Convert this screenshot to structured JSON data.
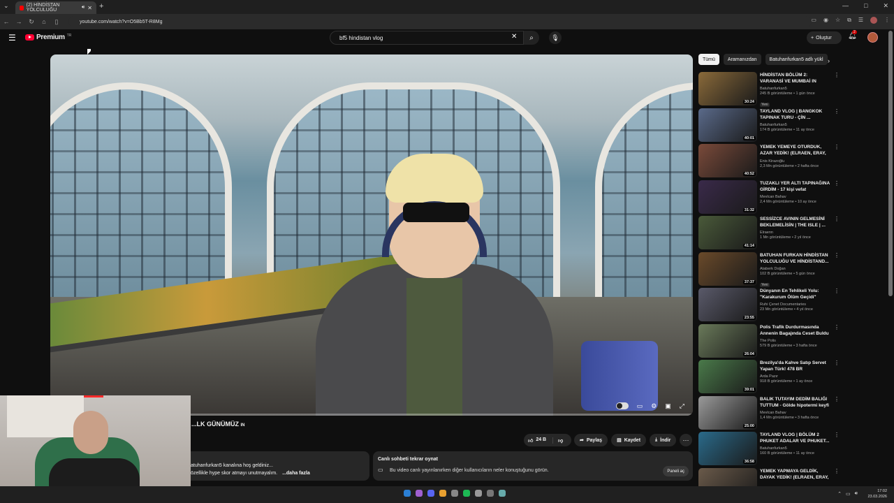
{
  "browser": {
    "tab_title": "(2) HİNDİSTAN YOLCULUĞU",
    "url": "youtube.com/watch?v=O5Bb5T-R8Mg",
    "new_tab_icon": "+",
    "minimize_icon": "—",
    "maximize_icon": "□",
    "close_icon": "✕"
  },
  "header": {
    "logo_text": "Premium",
    "logo_suffix": "TR",
    "search_value": "bf5 hindistan vlog",
    "create_label": "Oluştur",
    "notif_count": "2"
  },
  "video": {
    "title": "...LK GÜNÜMÜZ",
    "title_suffix": "IN",
    "like_count": "24 B",
    "share_label": "Paylaş",
    "save_label": "Kaydet",
    "download_label": "İndir"
  },
  "description": {
    "line1": "atuhanfurkan5 kanalına hoş geldiniz...",
    "line2": "özellikle hype skor atmayı unutmayalım.",
    "more": "...daha fazla"
  },
  "live_chat": {
    "heading": "Canlı sohbeti tekrar oynat",
    "text": "Bu video canlı yayınlanırken diğer kullanıcıların neler konuştuğunu görün.",
    "button": "Paneli aç"
  },
  "chips": [
    "Tümü",
    "Aramanızdan",
    "Batuhanfurkan5 adlı yükl"
  ],
  "recommendations": [
    {
      "title": "HİNDİSTAN BÖLÜM 2: VARANASİ VE MUMBAİ",
      "suffix": "IN",
      "channel": "Batuhanfurkan5",
      "stats": "245 B görüntüleme • 1 gün önce",
      "badge": "Yeni",
      "duration": "30:24",
      "color": "#8a6a3a"
    },
    {
      "title": "TAYLAND VLOG | BANGKOK TAPINAK TURU - ÇİN ...",
      "suffix": "",
      "channel": "Batuhanfurkan5",
      "stats": "174 B görüntüleme • 11 ay önce",
      "badge": "",
      "duration": "40:01",
      "color": "#5a6a8a"
    },
    {
      "title": "YEMEK YEMEYE OTURDUK, AZAR YEDİK! (ELRAEN, ERAY, ...",
      "suffix": "",
      "channel": "Enis Kirazoğlu",
      "stats": "2,3 Mn görüntüleme • 2 hafta önce",
      "badge": "",
      "duration": "40:52",
      "color": "#7a4a3a"
    },
    {
      "title": "TUZAKLI YER ALTI TAPINAĞINA GİRDİM - 17 kişi vefat",
      "suffix": "",
      "channel": "Mevlcan Bahav",
      "stats": "2,4 Mn görüntüleme • 10 ay önce",
      "badge": "",
      "duration": "31:32",
      "color": "#3a2a4a"
    },
    {
      "title": "SESSİZCE AVININ GELMESİNİ BEKLEMELİSİN | THE ISLE | ...",
      "suffix": "",
      "channel": "Elraenn",
      "stats": "1 Mn görüntüleme • 2 yıl önce",
      "badge": "",
      "duration": "41:14",
      "color": "#4a5a3a"
    },
    {
      "title": "BATUHAN FURKAN HİNDİSTAN YOLCULUĞU VE HİNDİSTAND...",
      "suffix": "",
      "channel": "Ataberk Doğan",
      "stats": "102 B görüntüleme • 5 gün önce",
      "badge": "Yeni",
      "duration": "37:37",
      "color": "#6a4a2a"
    },
    {
      "title": "Dünyanın En Tehlikeli Yolu: \"Karakurum Ölüm Geçidi\"",
      "suffix": "",
      "channel": "Ruhi Çenet Documentaries",
      "stats": "23 Mn görüntüleme • 4 yıl önce",
      "badge": "",
      "duration": "23:55",
      "color": "#5a5a6a"
    },
    {
      "title": "Polis Trafik Durdurmasında Annenin Bagajında Ceset Buldu",
      "suffix": "",
      "channel": "The Polis",
      "stats": "579 B görüntüleme • 3 hafta önce",
      "badge": "",
      "duration": "26:04",
      "color": "#6a7a5a"
    },
    {
      "title": "Brezilya'da Kahve Satıp Servet Yapan Türk! 478",
      "suffix": "BR",
      "channel": "Arda Pazır",
      "stats": "918 B görüntüleme • 1 ay önce",
      "badge": "",
      "duration": "39:01",
      "color": "#4a7a4a"
    },
    {
      "title": "BALIK TUTAYIM DEDİM BALIĞI TUTTUM - Gölde hipotermi keyfi",
      "suffix": "",
      "channel": "Mevlcan Bahav",
      "stats": "1,4 Mn görüntüleme • 3 hafta önce",
      "badge": "",
      "duration": "25:00",
      "color": "#9a9a9a"
    },
    {
      "title": "TAYLAND VLOG | BÖLÜM 2 PHUKET ADALAR VE PHUKET...",
      "suffix": "",
      "channel": "Batuhanfurkan5",
      "stats": "160 B görüntüleme • 11 ay önce",
      "badge": "",
      "duration": "36:58",
      "color": "#2a6a8a"
    },
    {
      "title": "YEMEK YAPMAYA GELDİK, DAYAK YEDİK! (ELRAEN, ERAY, ...",
      "suffix": "",
      "channel": "",
      "stats": "",
      "badge": "",
      "duration": "",
      "color": "#6a5a4a"
    }
  ],
  "taskbar": {
    "time": "17:02",
    "date": "23.03.2026"
  }
}
